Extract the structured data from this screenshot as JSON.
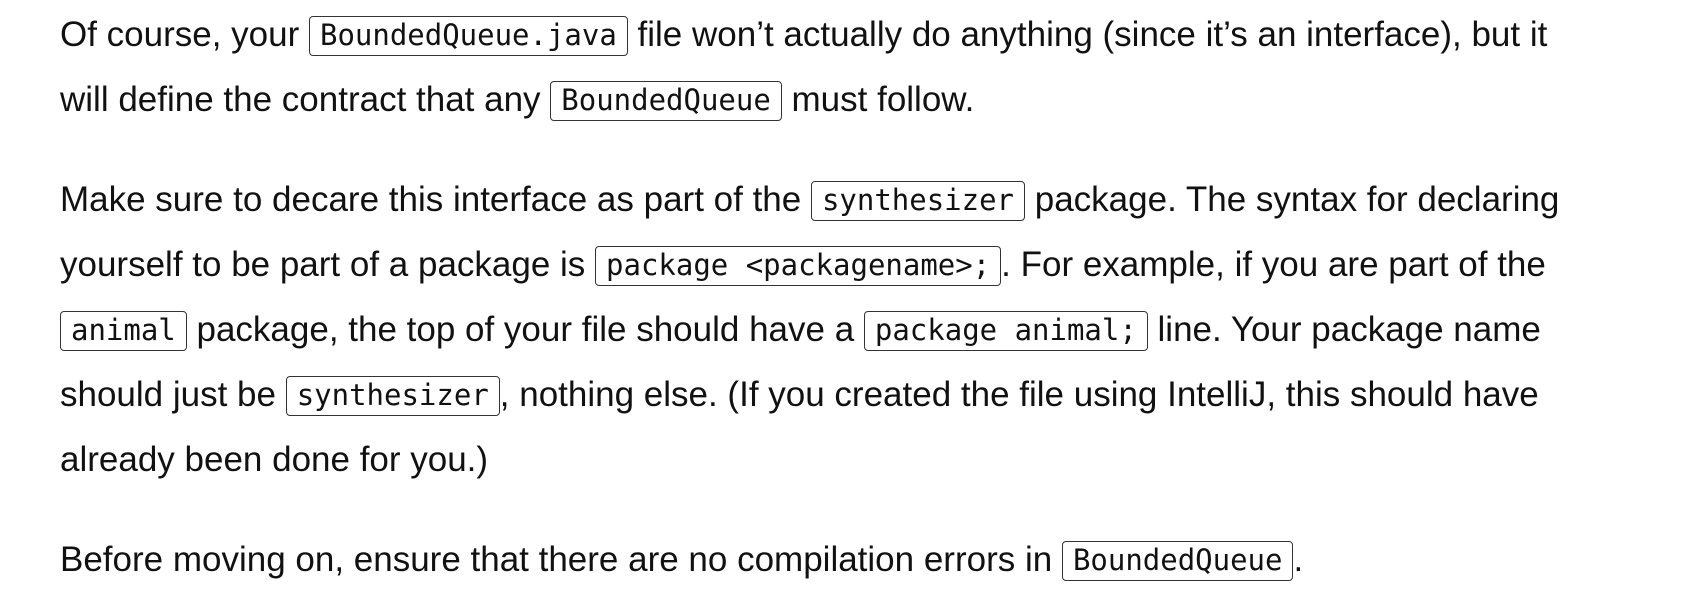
{
  "paragraph1": {
    "l1": {
      "t1": "Of course, your ",
      "c1": "BoundedQueue.java",
      "t2": " file won’t actually do anything (since it’s an interface), but it"
    },
    "l2": {
      "t1": "will define the contract that any ",
      "c1": "BoundedQueue",
      "t2": " must follow."
    }
  },
  "paragraph2": {
    "l1": {
      "t1": "Make sure to decare this interface as part of the ",
      "c1": "synthesizer",
      "t2": " package. The syntax for declaring"
    },
    "l2": {
      "t1": "yourself to be part of a package is ",
      "c1": "package <packagename>;",
      "t2": ". For example, if you are part of the"
    },
    "l3": {
      "c1": "animal",
      "t1": " package, the top of your file should have a ",
      "c2": "package animal;",
      "t2": " line. Your package name"
    },
    "l4": {
      "t1": "should just be ",
      "c1": "synthesizer",
      "t2": ", nothing else. (If you created the file using IntelliJ, this should have"
    },
    "l5": {
      "t1": "already been done for you.)"
    }
  },
  "paragraph3": {
    "l1": {
      "t1": "Before moving on, ensure that there are no compilation errors in ",
      "c1": "BoundedQueue",
      "t2": "."
    }
  }
}
